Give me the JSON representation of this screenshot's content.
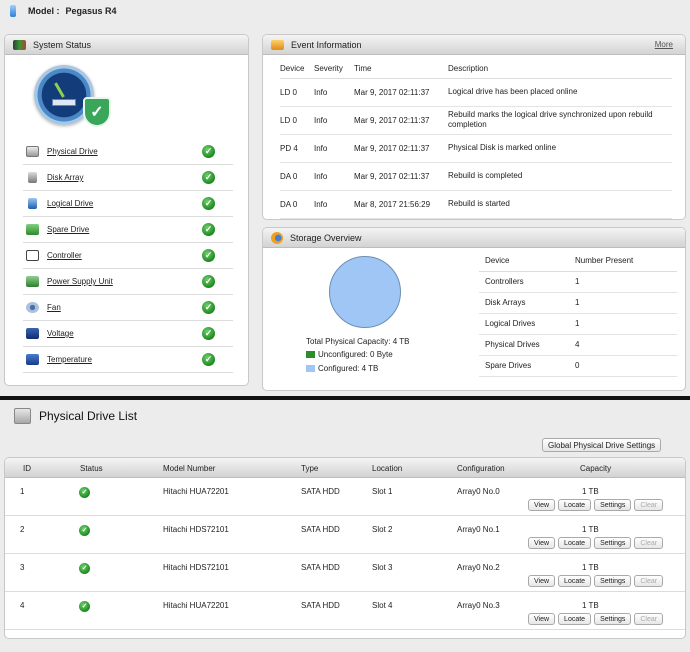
{
  "header": {
    "model_label": "Model :",
    "model_value": "Pegasus R4"
  },
  "system_status": {
    "title": "System Status",
    "items": [
      {
        "label": "Physical Drive",
        "icon": "physical-drive-icon"
      },
      {
        "label": "Disk Array",
        "icon": "disk-array-icon"
      },
      {
        "label": "Logical Drive",
        "icon": "logical-drive-icon"
      },
      {
        "label": "Spare Drive",
        "icon": "spare-drive-icon"
      },
      {
        "label": "Controller",
        "icon": "controller-icon"
      },
      {
        "label": "Power Supply Unit",
        "icon": "power-supply-icon"
      },
      {
        "label": "Fan",
        "icon": "fan-icon"
      },
      {
        "label": "Voltage",
        "icon": "voltage-icon"
      },
      {
        "label": "Temperature",
        "icon": "temperature-icon"
      }
    ]
  },
  "event_info": {
    "title": "Event Information",
    "more": "More",
    "columns": [
      "Device",
      "Severity",
      "Time",
      "Description"
    ],
    "rows": [
      {
        "device": "LD 0",
        "severity": "Info",
        "time": "Mar 9, 2017 02:11:37",
        "description": "Logical drive has been placed online"
      },
      {
        "device": "LD 0",
        "severity": "Info",
        "time": "Mar 9, 2017 02:11:37",
        "description": "Rebuild marks the logical drive synchronized upon rebuild completion"
      },
      {
        "device": "PD 4",
        "severity": "Info",
        "time": "Mar 9, 2017 02:11:37",
        "description": "Physical Disk is marked online"
      },
      {
        "device": "DA 0",
        "severity": "Info",
        "time": "Mar 9, 2017 02:11:37",
        "description": "Rebuild is completed"
      },
      {
        "device": "DA 0",
        "severity": "Info",
        "time": "Mar 8, 2017 21:56:29",
        "description": "Rebuild is started"
      }
    ]
  },
  "storage_overview": {
    "title": "Storage Overview",
    "total_capacity": "Total Physical Capacity: 4 TB",
    "unconfigured": "Unconfigured: 0 Byte",
    "configured": "Configured: 4 TB",
    "colors": {
      "unconfigured": "#2e8b2e",
      "configured": "#9fc6f5"
    },
    "columns": [
      "Device",
      "Number Present"
    ],
    "rows": [
      {
        "device": "Controllers",
        "count": "1"
      },
      {
        "device": "Disk Arrays",
        "count": "1"
      },
      {
        "device": "Logical Drives",
        "count": "1"
      },
      {
        "device": "Physical Drives",
        "count": "4"
      },
      {
        "device": "Spare Drives",
        "count": "0"
      }
    ]
  },
  "physical_drive_list": {
    "title": "Physical Drive List",
    "global_settings": "Global Physical Drive Settings",
    "columns": [
      "ID",
      "Status",
      "Model Number",
      "Type",
      "Location",
      "Configuration",
      "Capacity"
    ],
    "buttons": [
      "View",
      "Locate",
      "Settings",
      "Clear"
    ],
    "rows": [
      {
        "id": "1",
        "model": "Hitachi HUA72201",
        "type": "SATA HDD",
        "location": "Slot 1",
        "configuration": "Array0 No.0",
        "capacity": "1 TB"
      },
      {
        "id": "2",
        "model": "Hitachi HDS72101",
        "type": "SATA HDD",
        "location": "Slot 2",
        "configuration": "Array0 No.1",
        "capacity": "1 TB"
      },
      {
        "id": "3",
        "model": "Hitachi HDS72101",
        "type": "SATA HDD",
        "location": "Slot 3",
        "configuration": "Array0 No.2",
        "capacity": "1 TB"
      },
      {
        "id": "4",
        "model": "Hitachi HUA72201",
        "type": "SATA HDD",
        "location": "Slot 4",
        "configuration": "Array0 No.3",
        "capacity": "1 TB"
      }
    ]
  }
}
